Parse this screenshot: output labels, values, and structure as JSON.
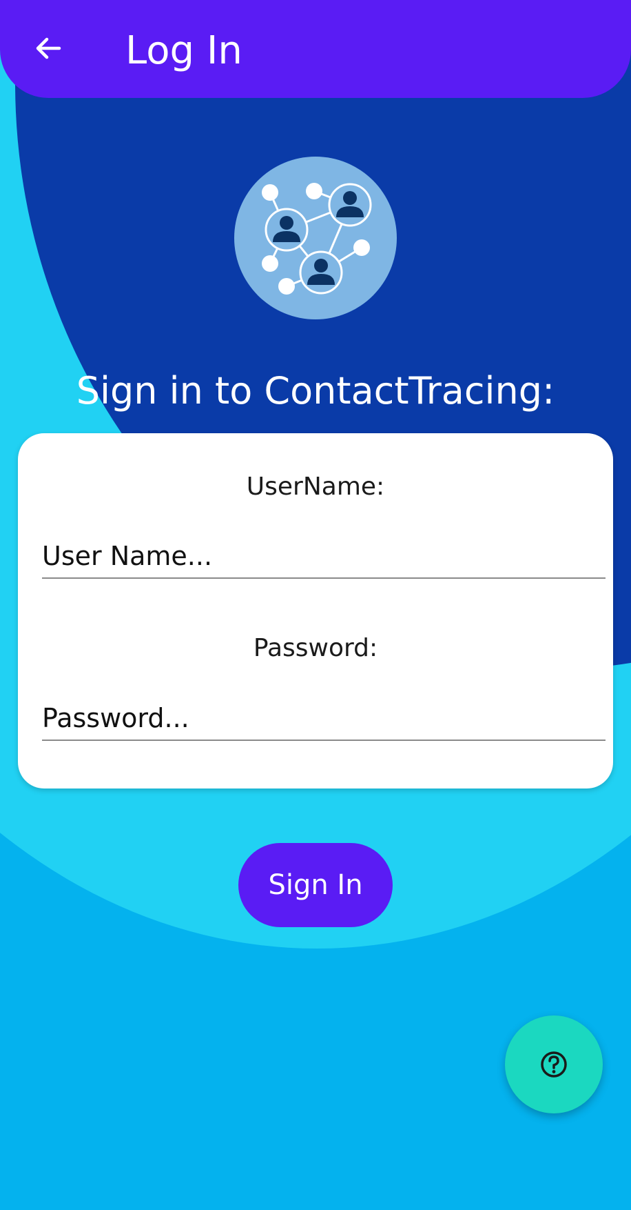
{
  "app_bar": {
    "title": "Log In",
    "back_icon": "arrow-left-icon"
  },
  "logo": {
    "icon": "contact-network-icon"
  },
  "heading": "Sign in to ContactTracing:",
  "form": {
    "username_label": "UserName:",
    "username_placeholder": "User Name...",
    "username_value": "",
    "password_label": "Password:",
    "password_placeholder": "Password...",
    "password_value": ""
  },
  "sign_in_button": "Sign In",
  "help_fab": {
    "icon": "help-circle-icon"
  },
  "colors": {
    "primary": "#5a1cf4",
    "dark_blue": "#0a3ba8",
    "light_cyan": "#21d1f3",
    "background": "#04b2ee",
    "fab": "#1bd8c0"
  }
}
